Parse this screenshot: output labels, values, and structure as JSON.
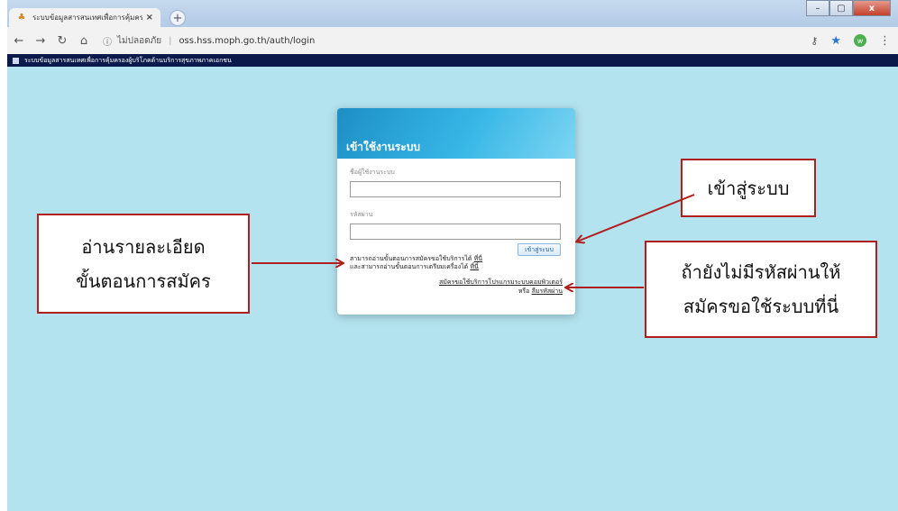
{
  "browser": {
    "tab_title": "ระบบข้อมูลสารสนเทศเพื่อการคุ้มครอง",
    "tab_close": "×",
    "new_tab": "+",
    "security_label": "ไม่ปลอดภัย",
    "url": "oss.hss.moph.go.th/auth/login",
    "avatar_letter": "w",
    "bookmark_title": "ระบบข้อมูลสารสนเทศเพื่อการคุ้มครองผู้บริโภคด้านบริการสุขภาพภาคเอกชน"
  },
  "login": {
    "heading": "เข้าใช้งานระบบ",
    "username_label": "ชื่อผู้ใช้งานระบบ",
    "password_label": "รหัสผ่าน",
    "submit_label": "เข้าสู่ระบบ",
    "help_line1": "สามารถอ่านขั้นตอนการสมัครขอใช้บริการได้ ",
    "help_link1": "ที่นี่",
    "help_line2": "และสามารถอ่านขั้นตอนการเตรียมเครื่องได้ ",
    "help_link2": "ที่นี่",
    "register_link": "สมัครขอใช้บริการโปรแกรมระบบคอมพิวเตอร์",
    "or_text": "หรือ ",
    "forgot_link": "ลืมรหัสผ่าน"
  },
  "callouts": {
    "left_line1": "อ่านรายละเอียด",
    "left_line2": "ขั้นตอนการสมัคร",
    "login_note": "เข้าสู่ระบบ",
    "right_line1": "ถ้ายังไม่มีรหัสผ่านให้",
    "right_line2": "สมัครขอใช้ระบบที่นี่"
  },
  "colors": {
    "page_background": "#b3e3ee",
    "callout_border": "#b01e1e",
    "bookmark_bar": "#0a1a4a"
  }
}
